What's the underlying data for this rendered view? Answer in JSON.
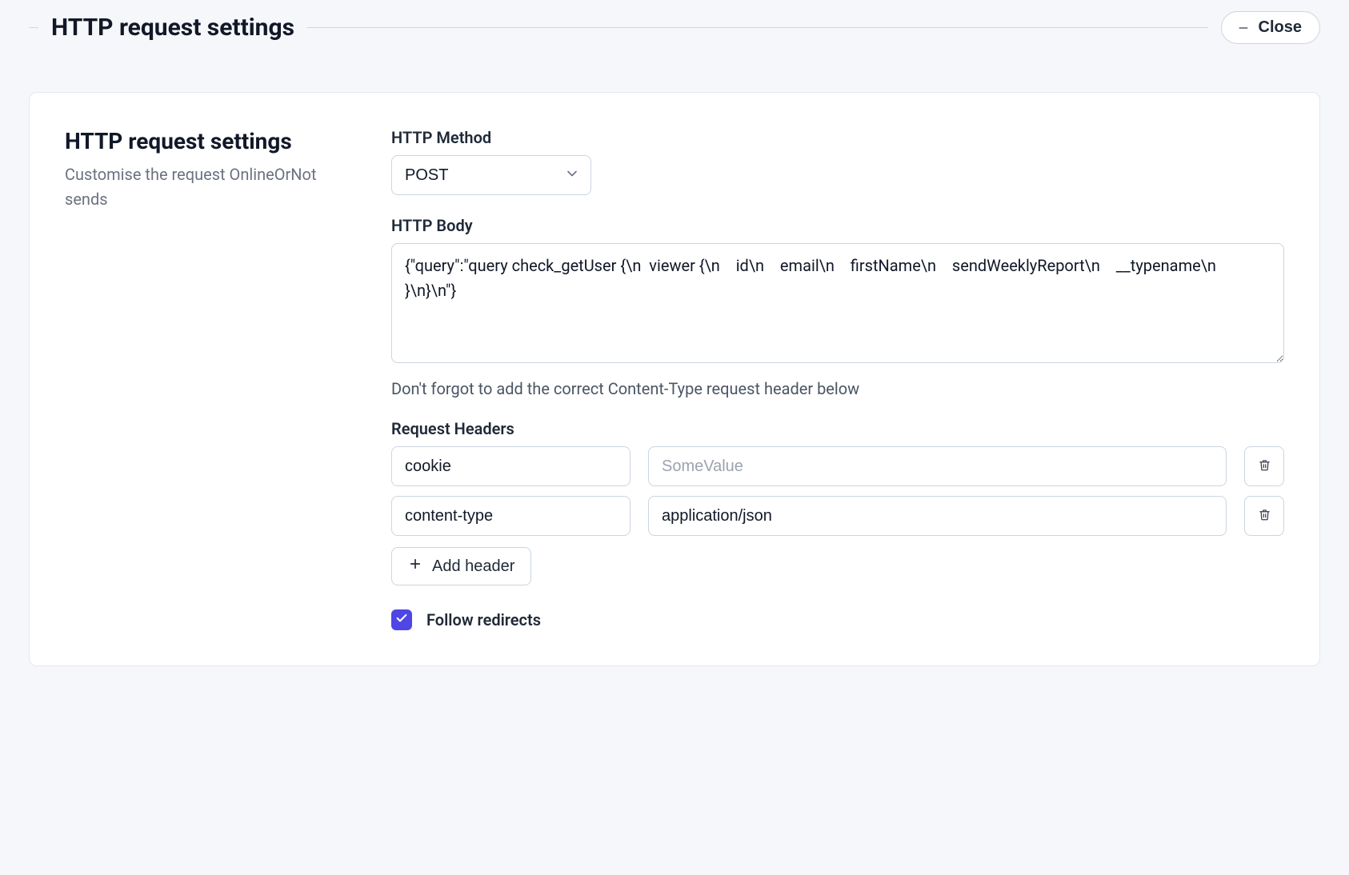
{
  "header": {
    "title": "HTTP request settings",
    "close_label": "Close"
  },
  "panel": {
    "heading": "HTTP request settings",
    "description": "Customise the request OnlineOrNot sends"
  },
  "form": {
    "method_label": "HTTP Method",
    "method_value": "POST",
    "body_label": "HTTP Body",
    "body_value": "{\"query\":\"query check_getUser {\\n  viewer {\\n    id\\n    email\\n    firstName\\n    sendWeeklyReport\\n    __typename\\n  }\\n}\\n\"}",
    "body_helper": "Don't forgot to add the correct Content-Type request header below",
    "headers_label": "Request Headers",
    "header_value_placeholder": "SomeValue",
    "headers": [
      {
        "name": "cookie",
        "value": ""
      },
      {
        "name": "content-type",
        "value": "application/json"
      }
    ],
    "add_header_label": "Add header",
    "follow_redirects_label": "Follow redirects",
    "follow_redirects_checked": true
  }
}
